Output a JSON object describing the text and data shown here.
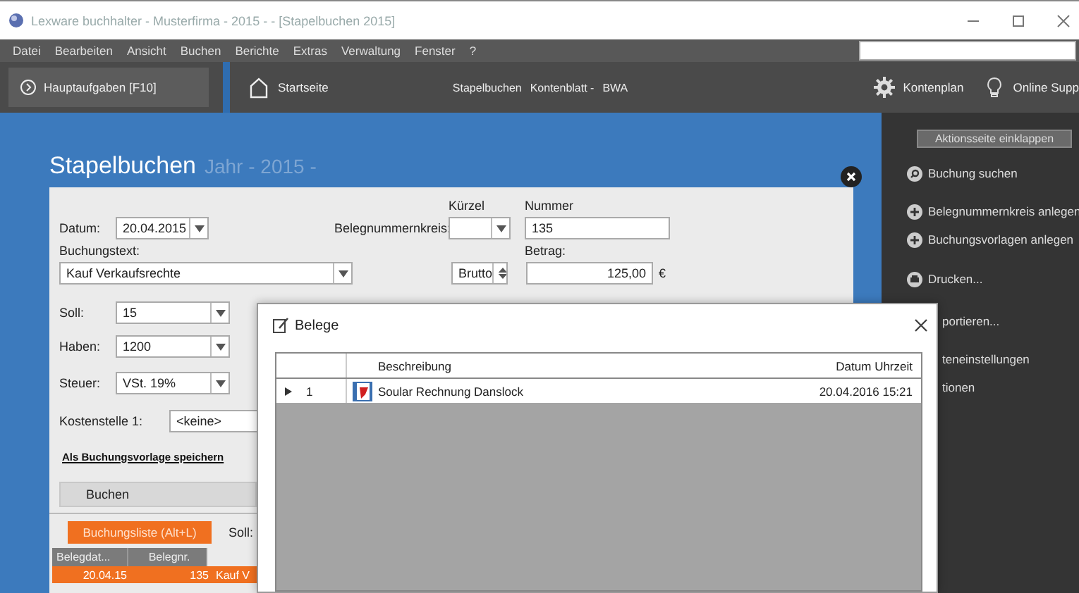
{
  "window": {
    "title": "Lexware buchhalter - Musterfirma - 2015 - - [Stapelbuchen 2015]"
  },
  "menu": [
    "Datei",
    "Bearbeiten",
    "Ansicht",
    "Buchen",
    "Berichte",
    "Extras",
    "Verwaltung",
    "Fenster",
    "?"
  ],
  "toolbar": {
    "main_button": "Hauptaufgaben [F10]",
    "home": "Startseite",
    "links": [
      "Stapelbuchen",
      "Kontenblatt -",
      "BWA"
    ],
    "right": [
      {
        "kind": "gear",
        "label": "Kontenplan"
      },
      {
        "kind": "bulb",
        "label": "Online Supp"
      }
    ]
  },
  "panel": {
    "title": "Stapelbuchen",
    "subtitle": "Jahr - 2015 -",
    "labels": {
      "kuerzel": "Kürzel",
      "nummer": "Nummer",
      "datum": "Datum:",
      "kreis": "Belegnummernkreis:",
      "buchungstext": "Buchungstext:",
      "betrag": "Betrag:",
      "kostenstelle": "Kostenstelle 1:"
    },
    "datum": "20.04.2015",
    "nummer": "135",
    "buchungstext": "Kauf Verkaufsrechte",
    "brutto": "Brutto",
    "betrag": "125,00",
    "currency": "€",
    "accounts": [
      {
        "label": "Soll:",
        "value": "15"
      },
      {
        "label": "Haben:",
        "value": "1200"
      },
      {
        "label": "Steuer:",
        "value": "VSt. 19%"
      }
    ],
    "kostenstelle": "<keine>",
    "save_link": "Als Buchungsvorlage speichern",
    "book_button": "Buchen",
    "list_tab": "Buchungsliste (Alt+L)",
    "soll_label": "Soll:",
    "list_columns": [
      "Belegdat...",
      "Belegnr."
    ],
    "list_rows": [
      {
        "date": "20.04.15",
        "number": "135",
        "text": "Kauf V",
        "selected": true
      }
    ]
  },
  "sidebar": {
    "collapse_button": "Aktionsseite einklappen",
    "items": [
      {
        "kind": "search",
        "label": "Buchung suchen"
      },
      {
        "kind": "add",
        "label": "Belegnummernkreis anlegen"
      },
      {
        "kind": "add",
        "label": "Buchungsvorlagen anlegen"
      },
      {
        "kind": "print",
        "label": "Drucken..."
      },
      {
        "kind": "none",
        "label": "portieren..."
      },
      {
        "kind": "none",
        "label": "teneinstellungen"
      },
      {
        "kind": "none",
        "label": "tionen"
      }
    ]
  },
  "dialog": {
    "title": "Belege",
    "columns": [
      "Beschreibung",
      "Datum Uhrzeit"
    ],
    "rows": [
      {
        "current": true,
        "index": "1",
        "description": "Soular Rechnung Danslock",
        "datetime": "20.04.2016 15:21"
      }
    ]
  }
}
